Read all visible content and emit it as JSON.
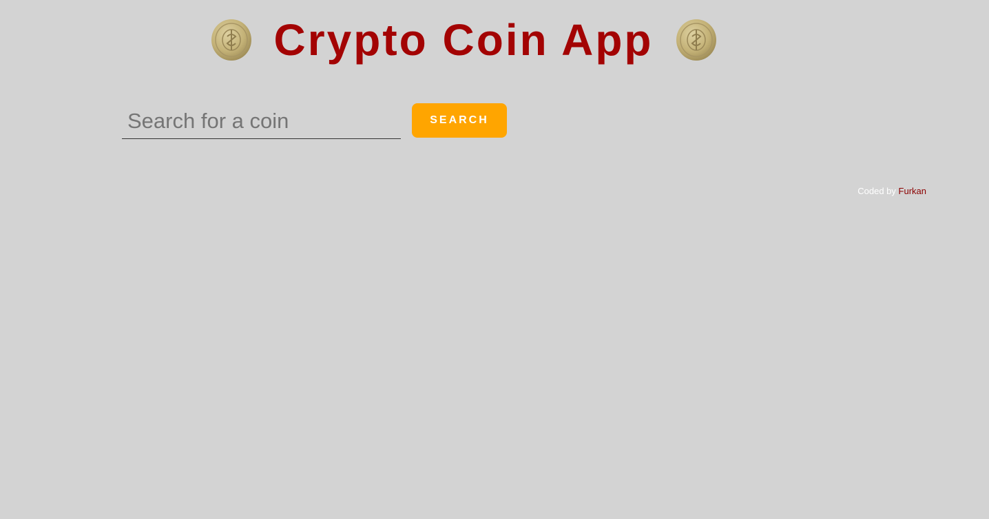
{
  "header": {
    "title": "Crypto Coin App",
    "left_icon": "coin-icon",
    "right_icon": "coin-icon"
  },
  "search": {
    "placeholder": "Search for a coin",
    "value": "",
    "button_label": "SEARCH"
  },
  "footer": {
    "prefix": "Coded by",
    "author": "Furkan"
  },
  "colors": {
    "background": "#d3d3d3",
    "title": "#a30303",
    "button": "#ffa500",
    "author_link": "#8b0000",
    "coin_gold": "#c9b77c"
  }
}
